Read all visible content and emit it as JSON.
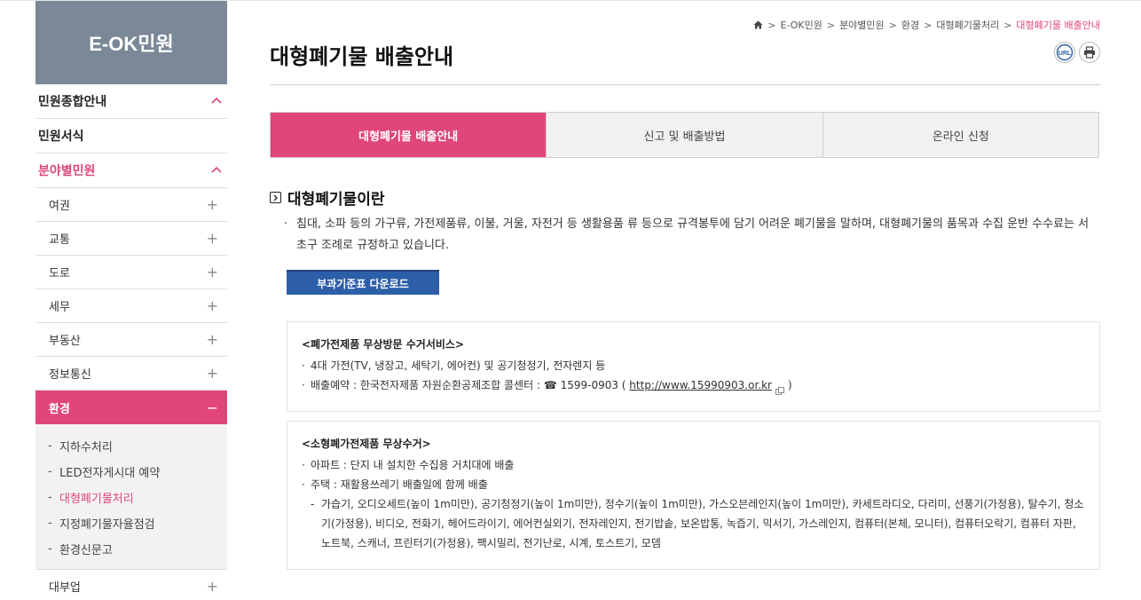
{
  "sidebar": {
    "title": "E-OK민원",
    "menu1": "민원종합안내",
    "menu2": "민원서식",
    "menu3": "분야별민원",
    "items": [
      "여권",
      "교통",
      "도로",
      "세무",
      "부동산",
      "정보통신"
    ],
    "active_item": "환경",
    "sub_items": [
      "지하수처리",
      "LED전자게시대 예약",
      "대형폐기물처리",
      "지정폐기물자율점검",
      "환경신문고"
    ],
    "last_item": "대부업"
  },
  "breadcrumb": {
    "items": [
      "E-OK민원",
      "분야별민원",
      "환경",
      "대형폐기물처리"
    ],
    "current": "대형폐기물 배출안내"
  },
  "page": {
    "title": "대형폐기물 배출안내",
    "url_label": "URL"
  },
  "tabs": [
    "대형폐기물 배출안내",
    "신고 및 배출방법",
    "온라인 신청"
  ],
  "section": {
    "title": "대형폐기물이란",
    "description": "침대, 소파 등의 가구류, 가전제품류, 이불, 거울, 자전거 등 생활용품 류 등으로 규격봉투에 담기 어려운 폐기물을 말하며, 대형폐기물의 품목과 수집 운반 수수료는 서초구 조례로 규정하고 있습니다.",
    "download_button": "부과기준표 다운로드"
  },
  "box1": {
    "heading": "<폐가전제품 무상방문 수거서비스>",
    "line1": "4대 가전(TV, 냉장고, 세탁기, 에어컨) 및 공기청정기, 전자렌지 등",
    "line2_prefix": "배출예약 : 한국전자제품 자원순환공제조합 콜센터 : ☎ 1599-0903 ( ",
    "link": "http://www.15990903.or.kr",
    "line2_suffix": ")"
  },
  "box2": {
    "heading": "<소형폐가전제품 무상수거>",
    "line1": "아파트 : 단지 내 설치한 수집용 거치대에 배출",
    "line2": "주택 : 재활용쓰레기 배출일에 함께 배출",
    "sub": "가습기, 오디오세트(높이 1m미만), 공기청정기(높이 1m미만), 정수기(높이 1m미만), 가스오븐레인지(높이 1m미만), 카세트라디오, 다리미, 선풍기(가정용), 탈수기, 청소기(가정용), 비디오, 전화기, 헤어드라이기, 에어컨실외기, 전자레인지, 전기밥솥, 보온밥통, 녹즙기, 믹서기, 가스레인지, 컴퓨터(본체, 모니터), 컴퓨터오락기, 컴퓨터 자판, 노트북, 스캐너, 프린터기(가정용), 팩시밀리, 전기난로, 시계, 토스트기, 모뎀"
  }
}
